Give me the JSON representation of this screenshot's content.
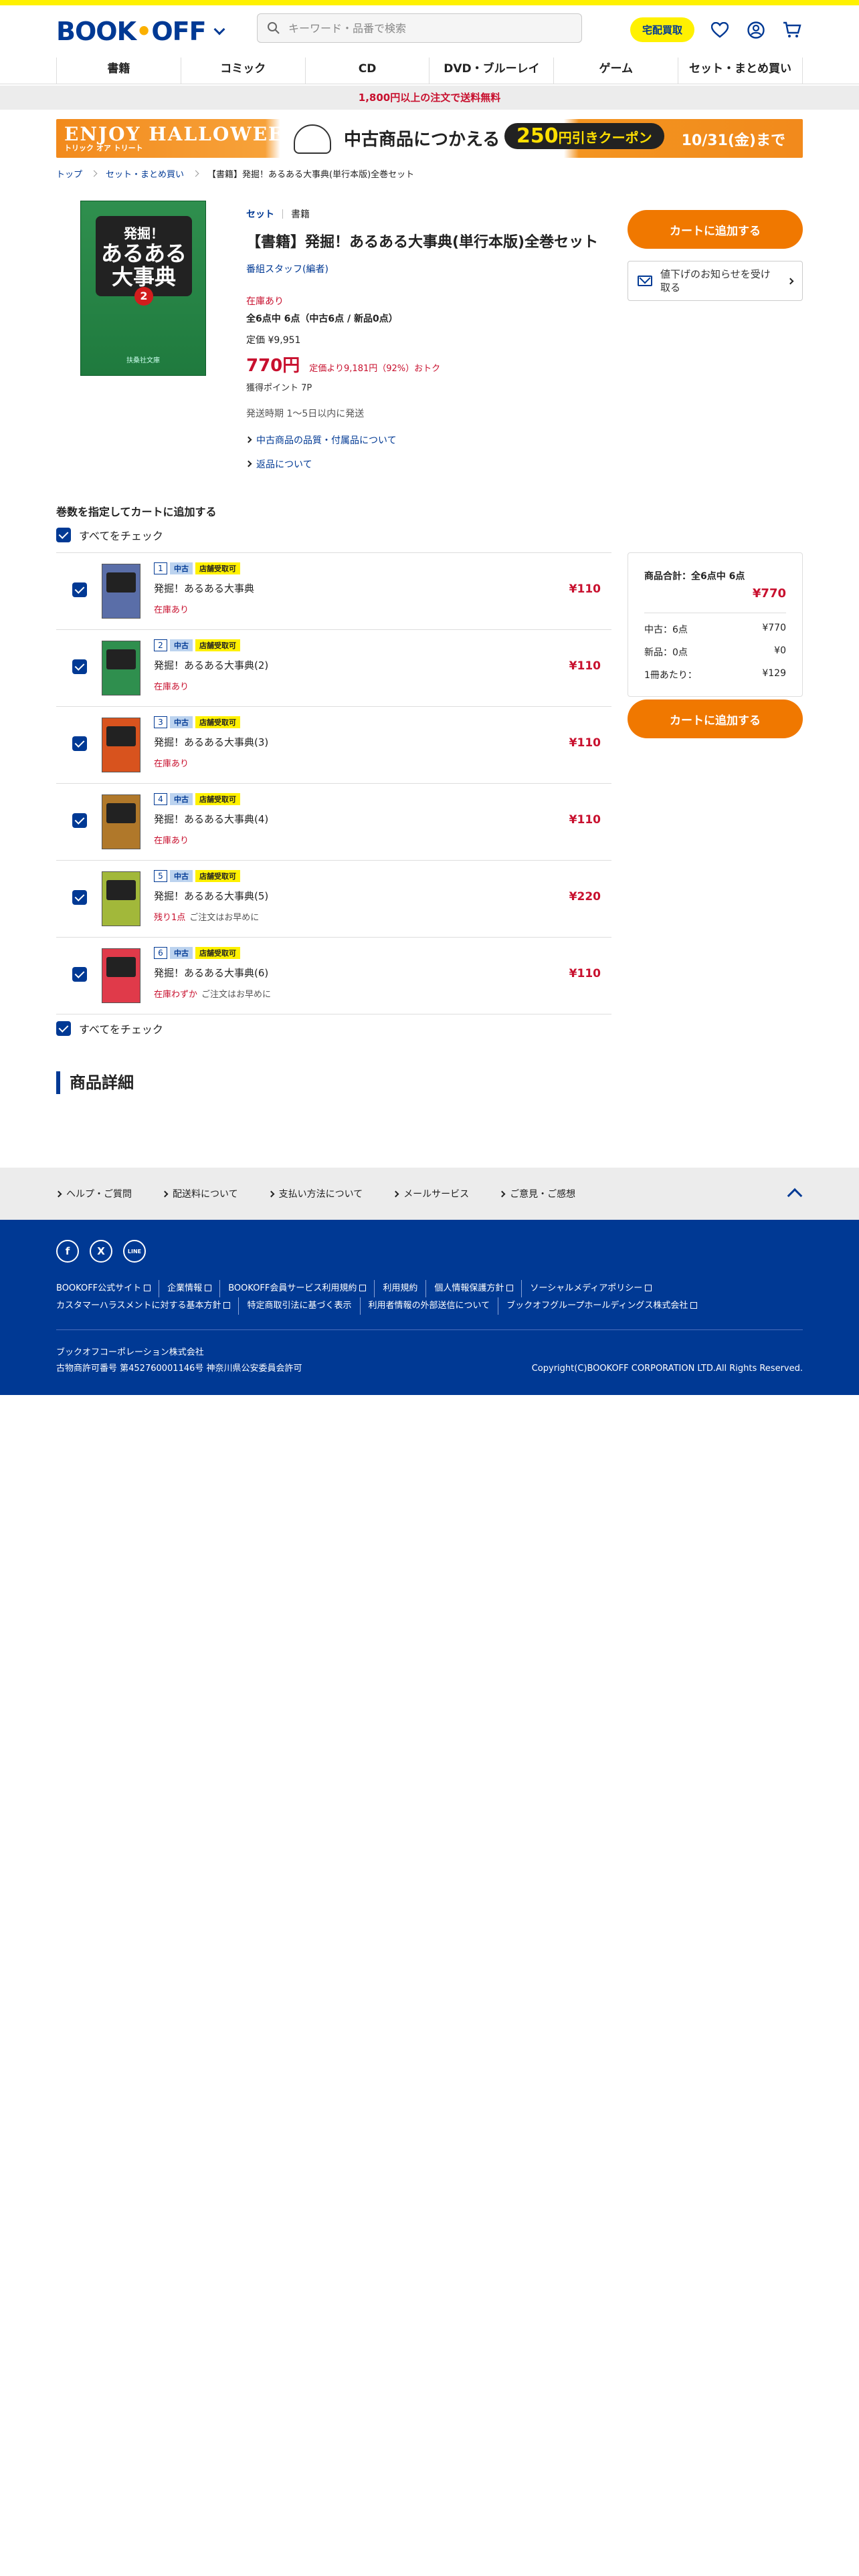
{
  "header": {
    "logo_text_left": "BOOK",
    "logo_dot": "•",
    "logo_text_right": "OFF",
    "search_placeholder": "キーワード・品番で検索",
    "takuhai_label": "宅配買取"
  },
  "nav": [
    "書籍",
    "コミック",
    "CD",
    "DVD・ブルーレイ",
    "ゲーム",
    "セット・まとめ買い"
  ],
  "shipping_notice": "1,800円以上の注文で送料無料",
  "banner": {
    "left_title": "ENJOY HALLOWEEN",
    "left_sub": "トリック オア トリート",
    "middle": "中古商品につかえる",
    "coupon_value": "250",
    "coupon_suffix": "円引きクーポン",
    "date": "10/31(金)まで"
  },
  "breadcrumb": [
    "トップ",
    "セット・まとめ買い",
    "【書籍】発掘！あるある大事典(単行本版)全巻セット"
  ],
  "cover": {
    "line1": "発掘！",
    "line2": "あるある",
    "line3": "大事典",
    "number": "2",
    "publisher": "扶桑社文庫"
  },
  "product": {
    "category1": "セット",
    "category2": "書籍",
    "title": "【書籍】発掘！あるある大事典(単行本版)全巻セット",
    "author": "番組スタッフ(編者)",
    "stock_status": "在庫あり",
    "stock_detail": "全6点中 6点（中古6点 / 新品0点）",
    "list_price": "定価 ¥9,951",
    "price": "770円",
    "discount": "定価より9,181円（92%）おトク",
    "points": "獲得ポイント 7P",
    "ship_time": "発送時期 1～5日以内に発送",
    "link_quality": "中古商品の品質・付属品について",
    "link_return": "返品について"
  },
  "buy": {
    "cart_label": "カートに追加する",
    "notify_label": "値下げのお知らせを受け取る"
  },
  "volumes_heading": "巻数を指定してカートに追加する",
  "check_all_label": "すべてをチェック",
  "badge_used": "中古",
  "badge_store": "店舗受取可",
  "volumes": [
    {
      "num": "1",
      "title": "発掘！あるある大事典",
      "stock": "在庫あり",
      "note": "",
      "price": "¥110",
      "color": "#5a6ea8"
    },
    {
      "num": "2",
      "title": "発掘！あるある大事典(2)",
      "stock": "在庫あり",
      "note": "",
      "price": "¥110",
      "color": "#2f8f4e"
    },
    {
      "num": "3",
      "title": "発掘！あるある大事典(3)",
      "stock": "在庫あり",
      "note": "",
      "price": "¥110",
      "color": "#d8531e"
    },
    {
      "num": "4",
      "title": "発掘！あるある大事典(4)",
      "stock": "在庫あり",
      "note": "",
      "price": "¥110",
      "color": "#b0782a"
    },
    {
      "num": "5",
      "title": "発掘！あるある大事典(5)",
      "stock": "残り1点",
      "note": "ご注文はお早めに",
      "price": "¥220",
      "color": "#a2b83a"
    },
    {
      "num": "6",
      "title": "発掘！あるある大事典(6)",
      "stock": "在庫わずか",
      "note": "ご注文はお早めに",
      "price": "¥110",
      "color": "#e03a4a"
    }
  ],
  "summary": {
    "title": "商品合計：全6点中 6点",
    "price": "¥770",
    "used_label": "中古：6点",
    "used_value": "¥770",
    "new_label": "新品：0点",
    "new_value": "¥0",
    "per_label": "1冊あたり：",
    "per_value": "¥129"
  },
  "detail_heading": "商品詳細",
  "footer_links": [
    "ヘルプ・ご質問",
    "配送料について",
    "支払い方法について",
    "メールサービス",
    "ご意見・ご感想"
  ],
  "social": {
    "facebook": "f",
    "x": "X",
    "line": "LINE"
  },
  "footer_nav": [
    {
      "label": "BOOKOFF公式サイト",
      "ext": true
    },
    {
      "label": "企業情報",
      "ext": true
    },
    {
      "label": "BOOKOFF会員サービス利用規約",
      "ext": true
    },
    {
      "label": "利用規約",
      "ext": false
    },
    {
      "label": "個人情報保護方針",
      "ext": true
    },
    {
      "label": "ソーシャルメディアポリシー",
      "ext": true
    },
    {
      "label": "カスタマーハラスメントに対する基本方針",
      "ext": true
    },
    {
      "label": "特定商取引法に基づく表示",
      "ext": false
    },
    {
      "label": "利用者情報の外部送信について",
      "ext": false
    },
    {
      "label": "ブックオフグループホールディングス株式会社",
      "ext": true
    }
  ],
  "company": "ブックオフコーポレーション株式会社",
  "license": "古物商許可番号 第452760001146号 神奈川県公安委員会許可",
  "copyright": "Copyright(C)BOOKOFF CORPORATION LTD.All Rights Reserved.",
  "colors": {
    "brand": "#003994",
    "accent": "#f07800",
    "price": "#c8102e",
    "yellow": "#fff100"
  }
}
